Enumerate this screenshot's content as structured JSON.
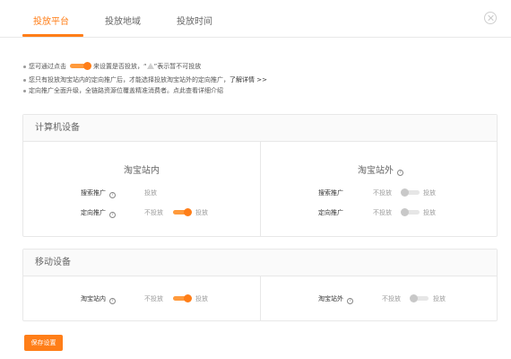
{
  "tabs": [
    {
      "label": "投放平台",
      "active": true
    },
    {
      "label": "投放地域",
      "active": false
    },
    {
      "label": "投放时间",
      "active": false
    }
  ],
  "notes": {
    "line1_prefix": "您可通过点击",
    "line1_mid": "来设置是否投放，“",
    "line1_suffix": "”表示暂不可投放",
    "line2_text": "您只有投放淘宝站内的定向推广后，才能选择投放淘宝站外的定向推广，",
    "line2_link": "了解详情 >>",
    "line3_text": "定向推广全面升级，全链路资源位覆盖精准消费者。点此查看详细介绍"
  },
  "computer": {
    "title": "计算机设备",
    "inside": {
      "title": "淘宝站内",
      "rows": [
        {
          "label": "搜索推广",
          "state_left": "",
          "state_right": "投放"
        },
        {
          "label": "定向推广",
          "state_left": "不投放",
          "state_right": "投放"
        }
      ]
    },
    "outside": {
      "title": "淘宝站外",
      "rows": [
        {
          "label": "搜索推广",
          "state_left": "不投放",
          "state_right": "投放"
        },
        {
          "label": "定向推广",
          "state_left": "不投放",
          "state_right": "投放"
        }
      ]
    }
  },
  "mobile": {
    "title": "移动设备",
    "inside": {
      "label": "淘宝站内",
      "state_left": "不投放",
      "state_right": "投放"
    },
    "outside": {
      "label": "淘宝站外",
      "state_left": "不投放",
      "state_right": "投放"
    }
  },
  "help_glyph": "?",
  "save_label": "保存设置",
  "colors": {
    "accent": "#ff7e18",
    "toggle_off": "#c8c8c8"
  },
  "icons": [
    "close-icon",
    "help-icon",
    "warning-icon"
  ]
}
